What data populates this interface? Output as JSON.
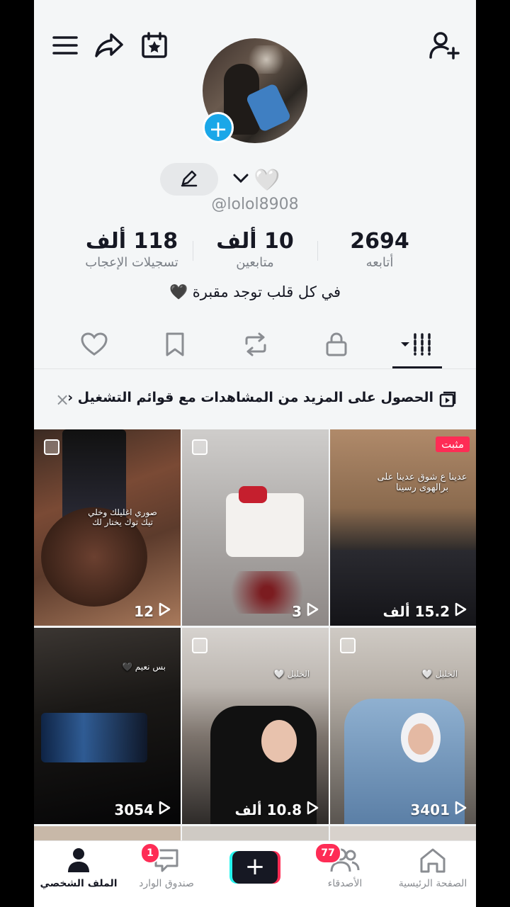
{
  "profile": {
    "username": "@lolol8908",
    "bio": "في كل قلب توجد مقبرة 🖤",
    "name_emoji": "🤍"
  },
  "stats": {
    "following": {
      "value": "2694",
      "label": "أتابعه"
    },
    "followers": {
      "value": "10 ألف",
      "label": "متابعين"
    },
    "likes": {
      "value": "118 ألف",
      "label": "تسجيلات الإعجاب"
    }
  },
  "banner": {
    "text": "الحصول على المزيد من المشاهدات مع قوائم التشغيل ‹",
    "close": "×"
  },
  "videos": [
    {
      "views": "12",
      "caption": "صوري اغليلك وخلي تيك توك يختار لك",
      "pinned": false
    },
    {
      "views": "3",
      "caption": "",
      "pinned": false
    },
    {
      "views": "15.2 ألف",
      "caption": "عدينا ع شوق عدينا على برالهوى رسينا",
      "pinned": true,
      "pinned_label": "مثبت"
    },
    {
      "views": "3054",
      "caption": "بس نعيم 🖤",
      "pinned": false
    },
    {
      "views": "10.8 ألف",
      "caption": "الخليل 🤍",
      "pinned": false
    },
    {
      "views": "3401",
      "caption": "الخليل 🤍",
      "pinned": false
    }
  ],
  "nav": {
    "profile": "الملف الشخصي",
    "inbox": "صندوق الوارد",
    "inbox_badge": "1",
    "friends": "الأصدقاء",
    "friends_badge": "77",
    "home": "الصفحة الرئيسية",
    "create": "+"
  },
  "icons": [
    "menu-icon",
    "share-icon",
    "calendar-star-icon",
    "add-user-icon",
    "pencil-icon",
    "chevron-down-icon",
    "heart-outline-icon",
    "bookmark-icon",
    "repost-icon",
    "lock-icon",
    "grid-icon",
    "playlist-icon",
    "play-icon",
    "person-icon",
    "chat-icon",
    "friends-icon",
    "home-icon"
  ],
  "colors": {
    "accent": "#fe2c55",
    "blue": "#1aa7e8",
    "text": "#161823"
  }
}
